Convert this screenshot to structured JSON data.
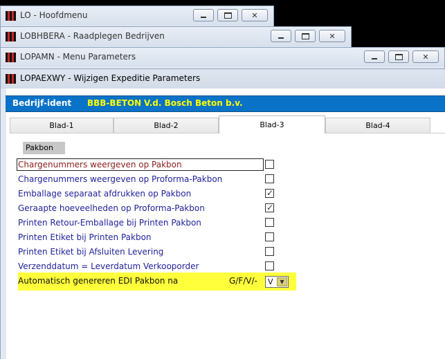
{
  "windows": [
    {
      "title": "LO - Hoofdmenu"
    },
    {
      "title": "LOBHBERA - Raadplegen Bedrijven"
    },
    {
      "title": "LOPAMN - Menu Parameters"
    },
    {
      "title": "LOPAEXWY - Wijzigen Expeditie Parameters"
    }
  ],
  "controls": {
    "minimize": "",
    "maximize": "",
    "close": "✕"
  },
  "ident": {
    "label": "Bedrijf-ident",
    "code": "BBB-BETON",
    "name": "V.d. Bosch Beton b.v."
  },
  "tabs": [
    {
      "label": "Blad-1"
    },
    {
      "label": "Blad-2"
    },
    {
      "label": "Blad-3"
    },
    {
      "label": "Blad-4"
    }
  ],
  "active_tab": "Blad-3",
  "group_label": "Pakbon",
  "options": [
    {
      "label": "Chargenummers weergeven op Pakbon",
      "checked": false,
      "mark": ""
    },
    {
      "label": "Chargenummers weergeven op Proforma-Pakbon",
      "checked": false,
      "mark": ""
    },
    {
      "label": "Emballage separaat afdrukken op Pakbon",
      "checked": true,
      "mark": "✓"
    },
    {
      "label": "Geraapte hoeveelheden op Proforma-Pakbon",
      "checked": true,
      "mark": "✓"
    },
    {
      "label": "Printen Retour-Emballage bij Printen Pakbon",
      "checked": false,
      "mark": ""
    },
    {
      "label": "Printen Etiket bij Printen Pakbon",
      "checked": false,
      "mark": ""
    },
    {
      "label": "Printen Etiket bij Afsluiten Levering",
      "checked": false,
      "mark": ""
    },
    {
      "label": "Verzenddatum = Leverdatum Verkooporder",
      "checked": false,
      "mark": ""
    }
  ],
  "edi": {
    "label": "Automatisch genereren EDI Pakbon na",
    "hint": "G/F/V/-",
    "value": "V",
    "dropdown_glyph": "▼"
  },
  "colors": {
    "ident_bar": "#0a73c8",
    "ident_value": "#ffff00",
    "highlight": "#ffff3b",
    "option_text": "#1f1f9a"
  }
}
